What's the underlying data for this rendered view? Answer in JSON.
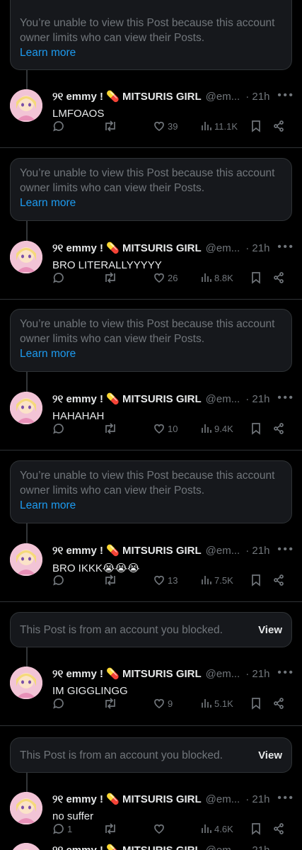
{
  "notices": {
    "limited": "You’re unable to view this Post because this account owner limits who can view their Posts.",
    "learn_more": "Learn more",
    "blocked": "This Post is from an account you blocked.",
    "view": "View"
  },
  "author": {
    "name": "୨୧ emmy ! 💊 MITSURIS GIRL",
    "handle": "@em...",
    "time": "· 21h"
  },
  "posts": [
    {
      "text": "LMFOAOS",
      "replies": "",
      "likes": "39",
      "views": "11.1K"
    },
    {
      "text": "BRO LITERALLYYYYY",
      "replies": "",
      "likes": "26",
      "views": "8.8K"
    },
    {
      "text": "HAHAHAH",
      "replies": "",
      "likes": "10",
      "views": "9.4K"
    },
    {
      "text": "BRO IKKK😭😭😭",
      "replies": "",
      "likes": "13",
      "views": "7.5K"
    },
    {
      "text": "IM GIGGLINGG",
      "replies": "",
      "likes": "9",
      "views": "5.1K"
    },
    {
      "text": "no suffer",
      "replies": "1",
      "likes": "",
      "views": "4.6K"
    }
  ],
  "colors": {
    "background": "#000000",
    "card": "#16181c",
    "link": "#1d9bf0",
    "muted": "#71767b"
  },
  "icons": [
    "reply-icon",
    "retweet-icon",
    "heart-icon",
    "views-icon",
    "bookmark-icon",
    "share-icon",
    "more-icon"
  ]
}
